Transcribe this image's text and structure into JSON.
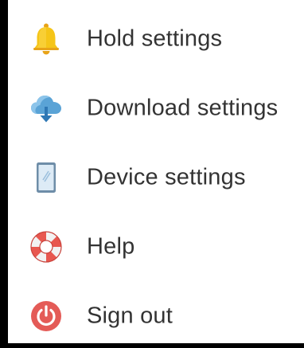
{
  "menu": {
    "items": [
      {
        "label": "Hold settings",
        "icon": "bell-icon",
        "color": "#F5C518"
      },
      {
        "label": "Download settings",
        "icon": "cloud-download-icon",
        "color": "#4A90C8"
      },
      {
        "label": "Device settings",
        "icon": "tablet-icon",
        "color": "#7FA8C9"
      },
      {
        "label": "Help",
        "icon": "lifebuoy-icon",
        "color": "#E8574F"
      },
      {
        "label": "Sign out",
        "icon": "power-icon",
        "color": "#E45B57"
      }
    ]
  }
}
